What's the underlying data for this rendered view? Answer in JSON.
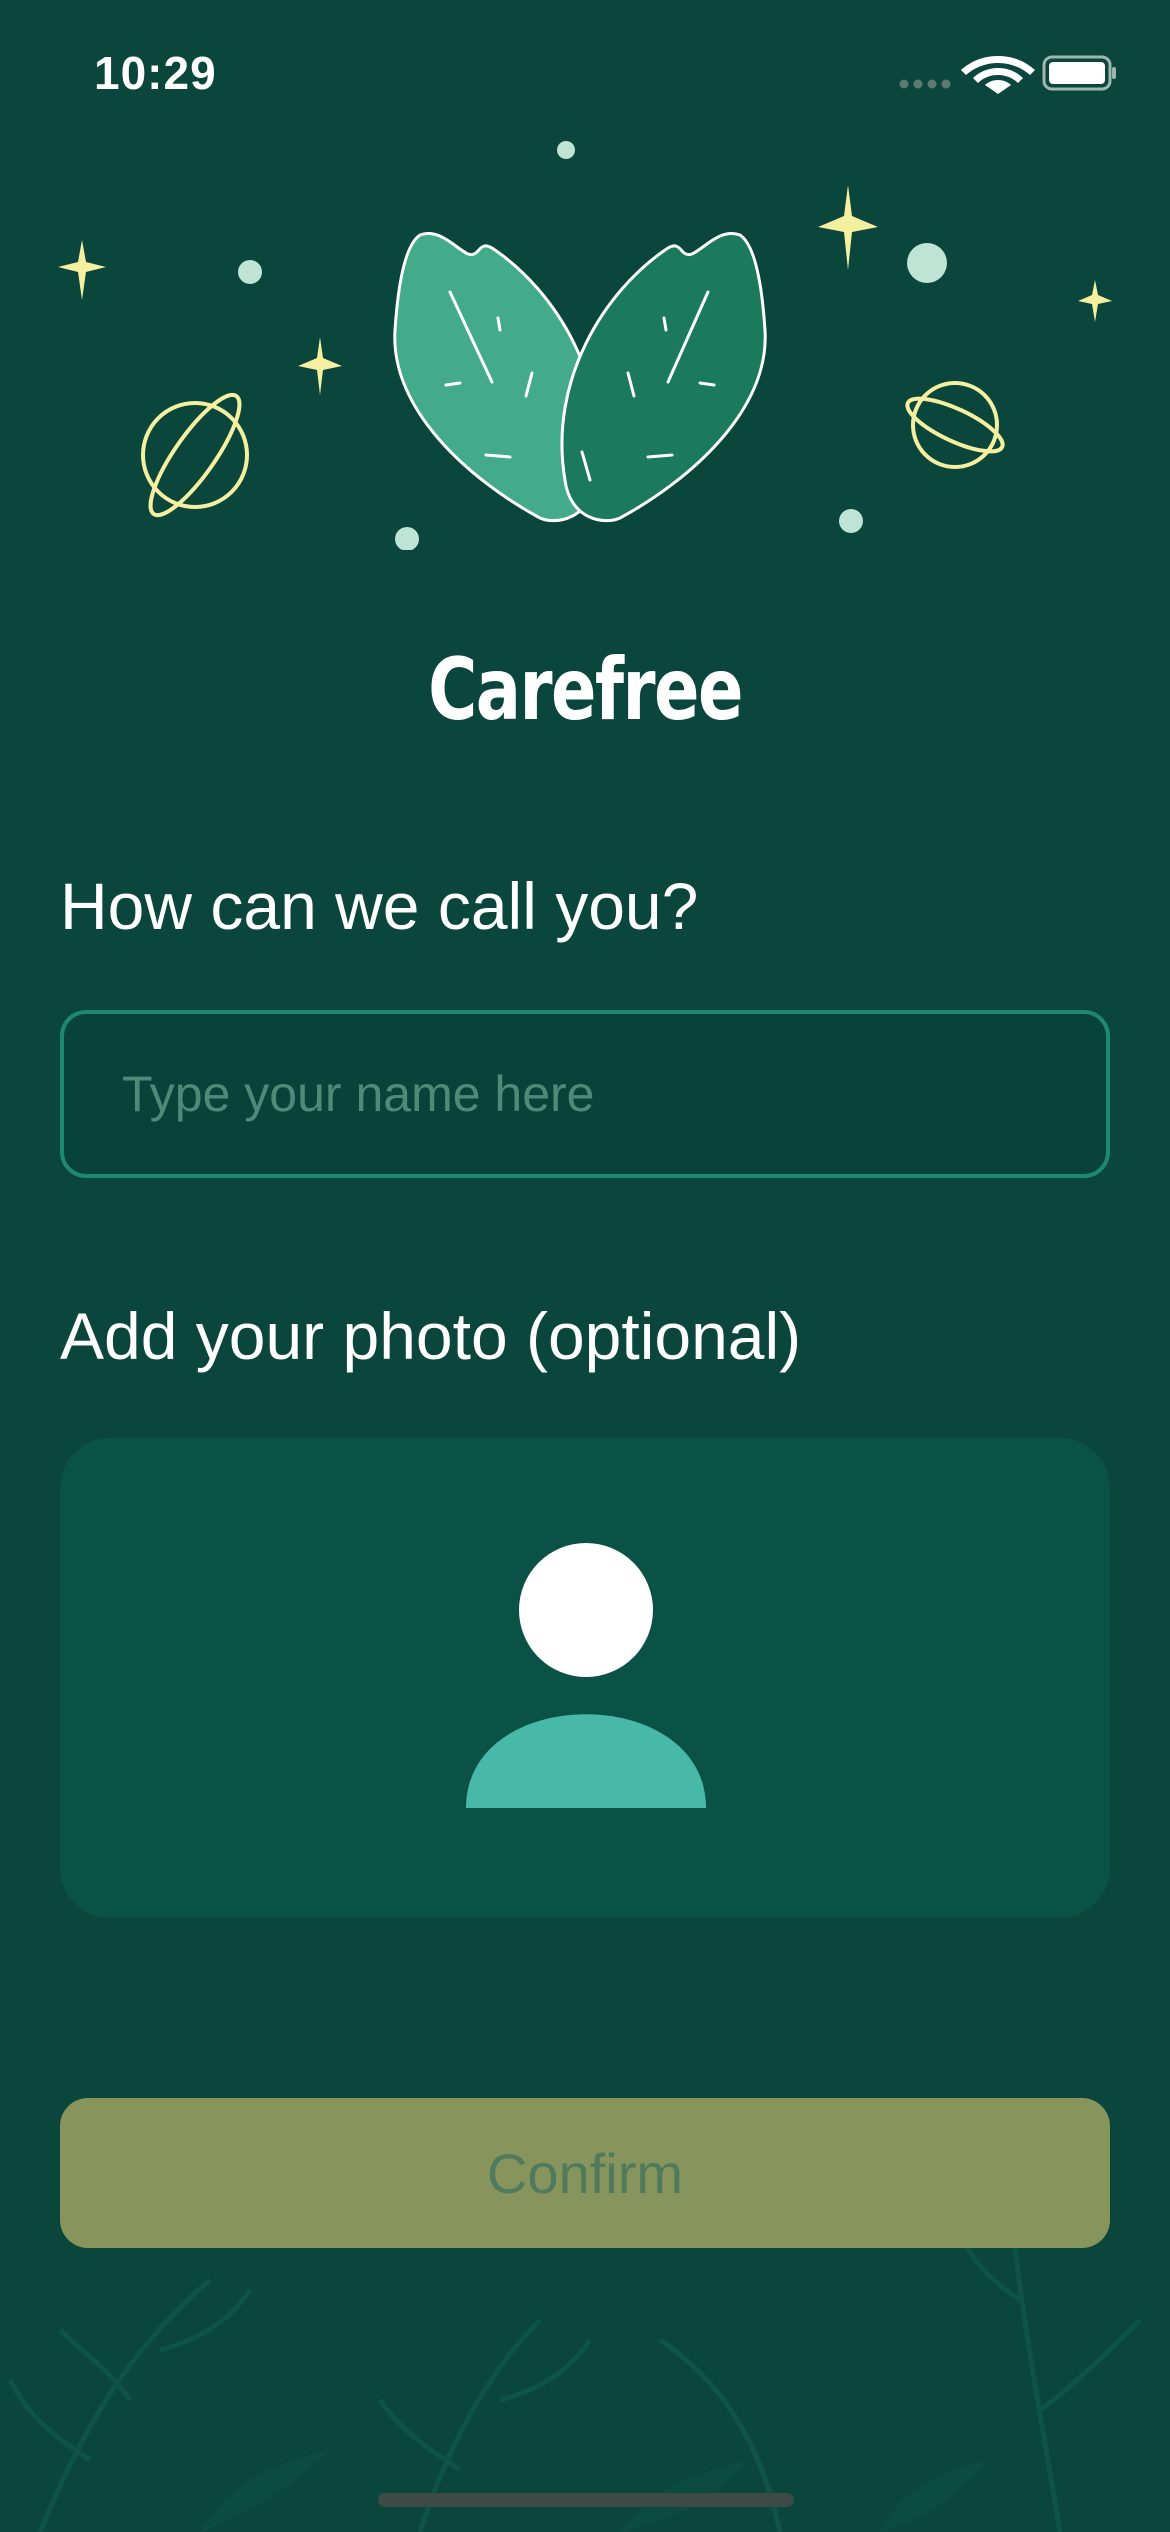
{
  "status_bar": {
    "time": "10:29",
    "icons": [
      "signal-dots-icon",
      "wifi-icon",
      "battery-icon"
    ]
  },
  "app": {
    "title": "Carefree",
    "logo_icon": "leaves-logo-icon"
  },
  "form": {
    "name_label": "How can we call you?",
    "name_placeholder": "Type your name here",
    "name_value": "",
    "photo_label": "Add your photo (optional)",
    "photo_icon": "avatar-placeholder-icon"
  },
  "actions": {
    "confirm_label": "Confirm"
  },
  "colors": {
    "background": "#0a463b",
    "input_border": "#1e8a6d",
    "photo_card": "#0b5246",
    "confirm_button": "#87955c",
    "confirm_text": "#4f7a5d",
    "accent_yellow": "#f5f0a0",
    "leaf_light": "#43ab8a",
    "leaf_dark": "#1c7a5c",
    "avatar_body": "#48b8a8"
  }
}
